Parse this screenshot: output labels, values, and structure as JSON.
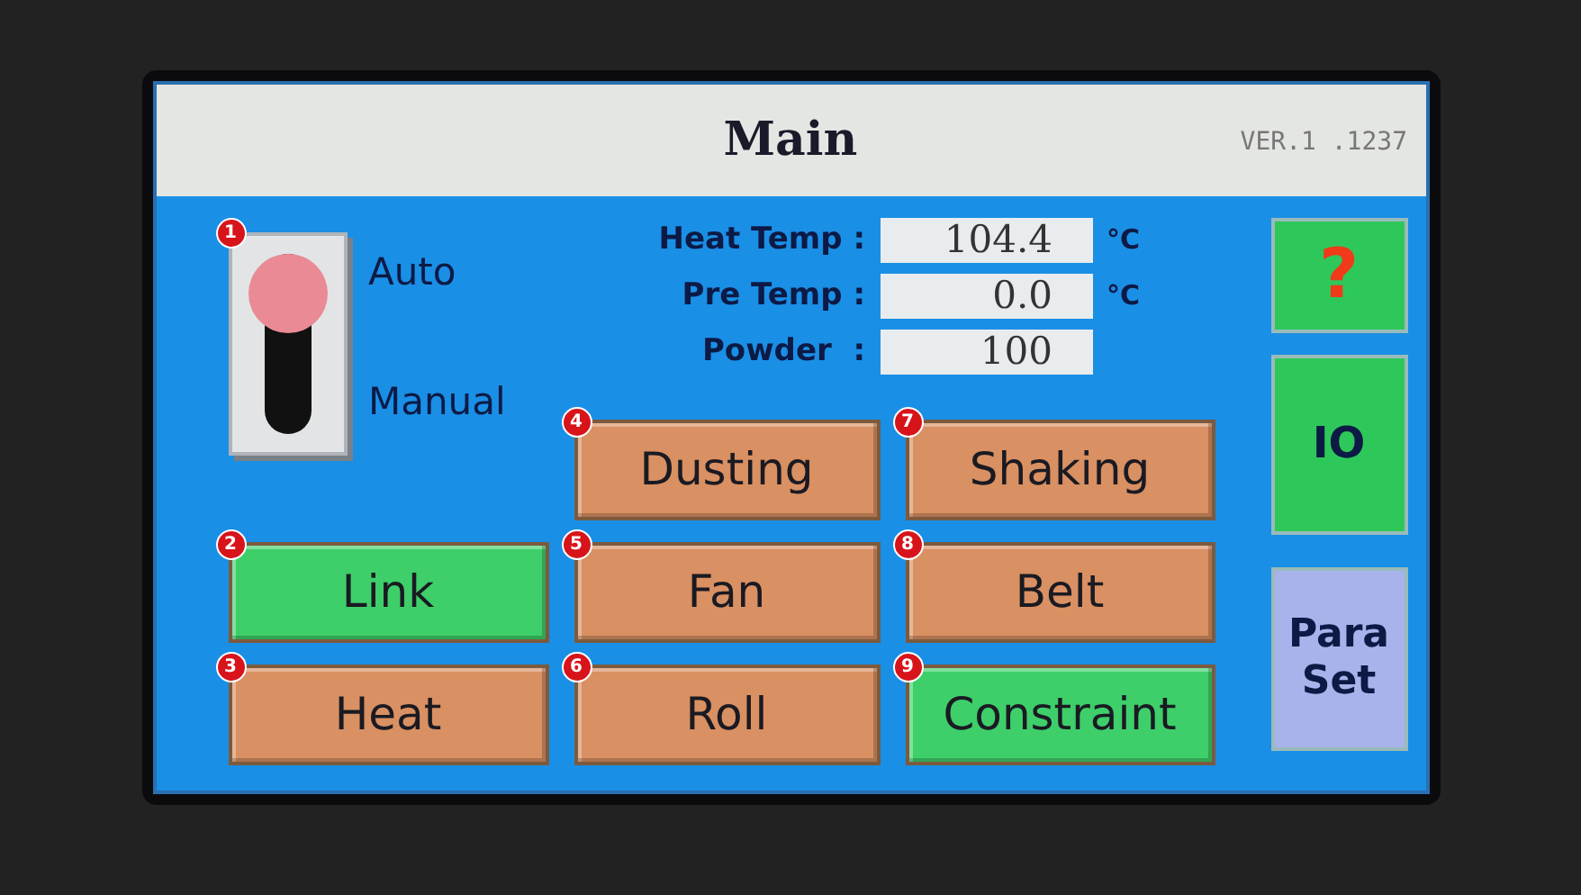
{
  "title": "Main",
  "version": "VER.1 .1237",
  "mode_switch": {
    "badge": "1",
    "auto": true,
    "labels": [
      "Auto",
      "Manual"
    ]
  },
  "readings": [
    {
      "label": "Heat Temp :",
      "value": "104.4",
      "unit": "°C"
    },
    {
      "label": "Pre Temp :",
      "value": "0.0",
      "unit": "°C"
    },
    {
      "label": "Powder  :",
      "value": "100"
    }
  ],
  "buttons": [
    {
      "badge": "2",
      "label": "Link",
      "on": true
    },
    {
      "badge": "3",
      "label": "Heat",
      "on": false
    },
    {
      "badge": "4",
      "label": "Dusting",
      "on": false
    },
    {
      "badge": "5",
      "label": "Fan",
      "on": false
    },
    {
      "badge": "6",
      "label": "Roll",
      "on": false
    },
    {
      "badge": "7",
      "label": "Shaking",
      "on": false
    },
    {
      "badge": "8",
      "label": "Belt",
      "on": false
    },
    {
      "badge": "9",
      "label": "Constraint",
      "on": true
    }
  ],
  "side_buttons": [
    {
      "kind": "help",
      "label": "?"
    },
    {
      "kind": "nav",
      "label": "IO"
    },
    {
      "kind": "settings",
      "label": "Para Set"
    }
  ]
}
